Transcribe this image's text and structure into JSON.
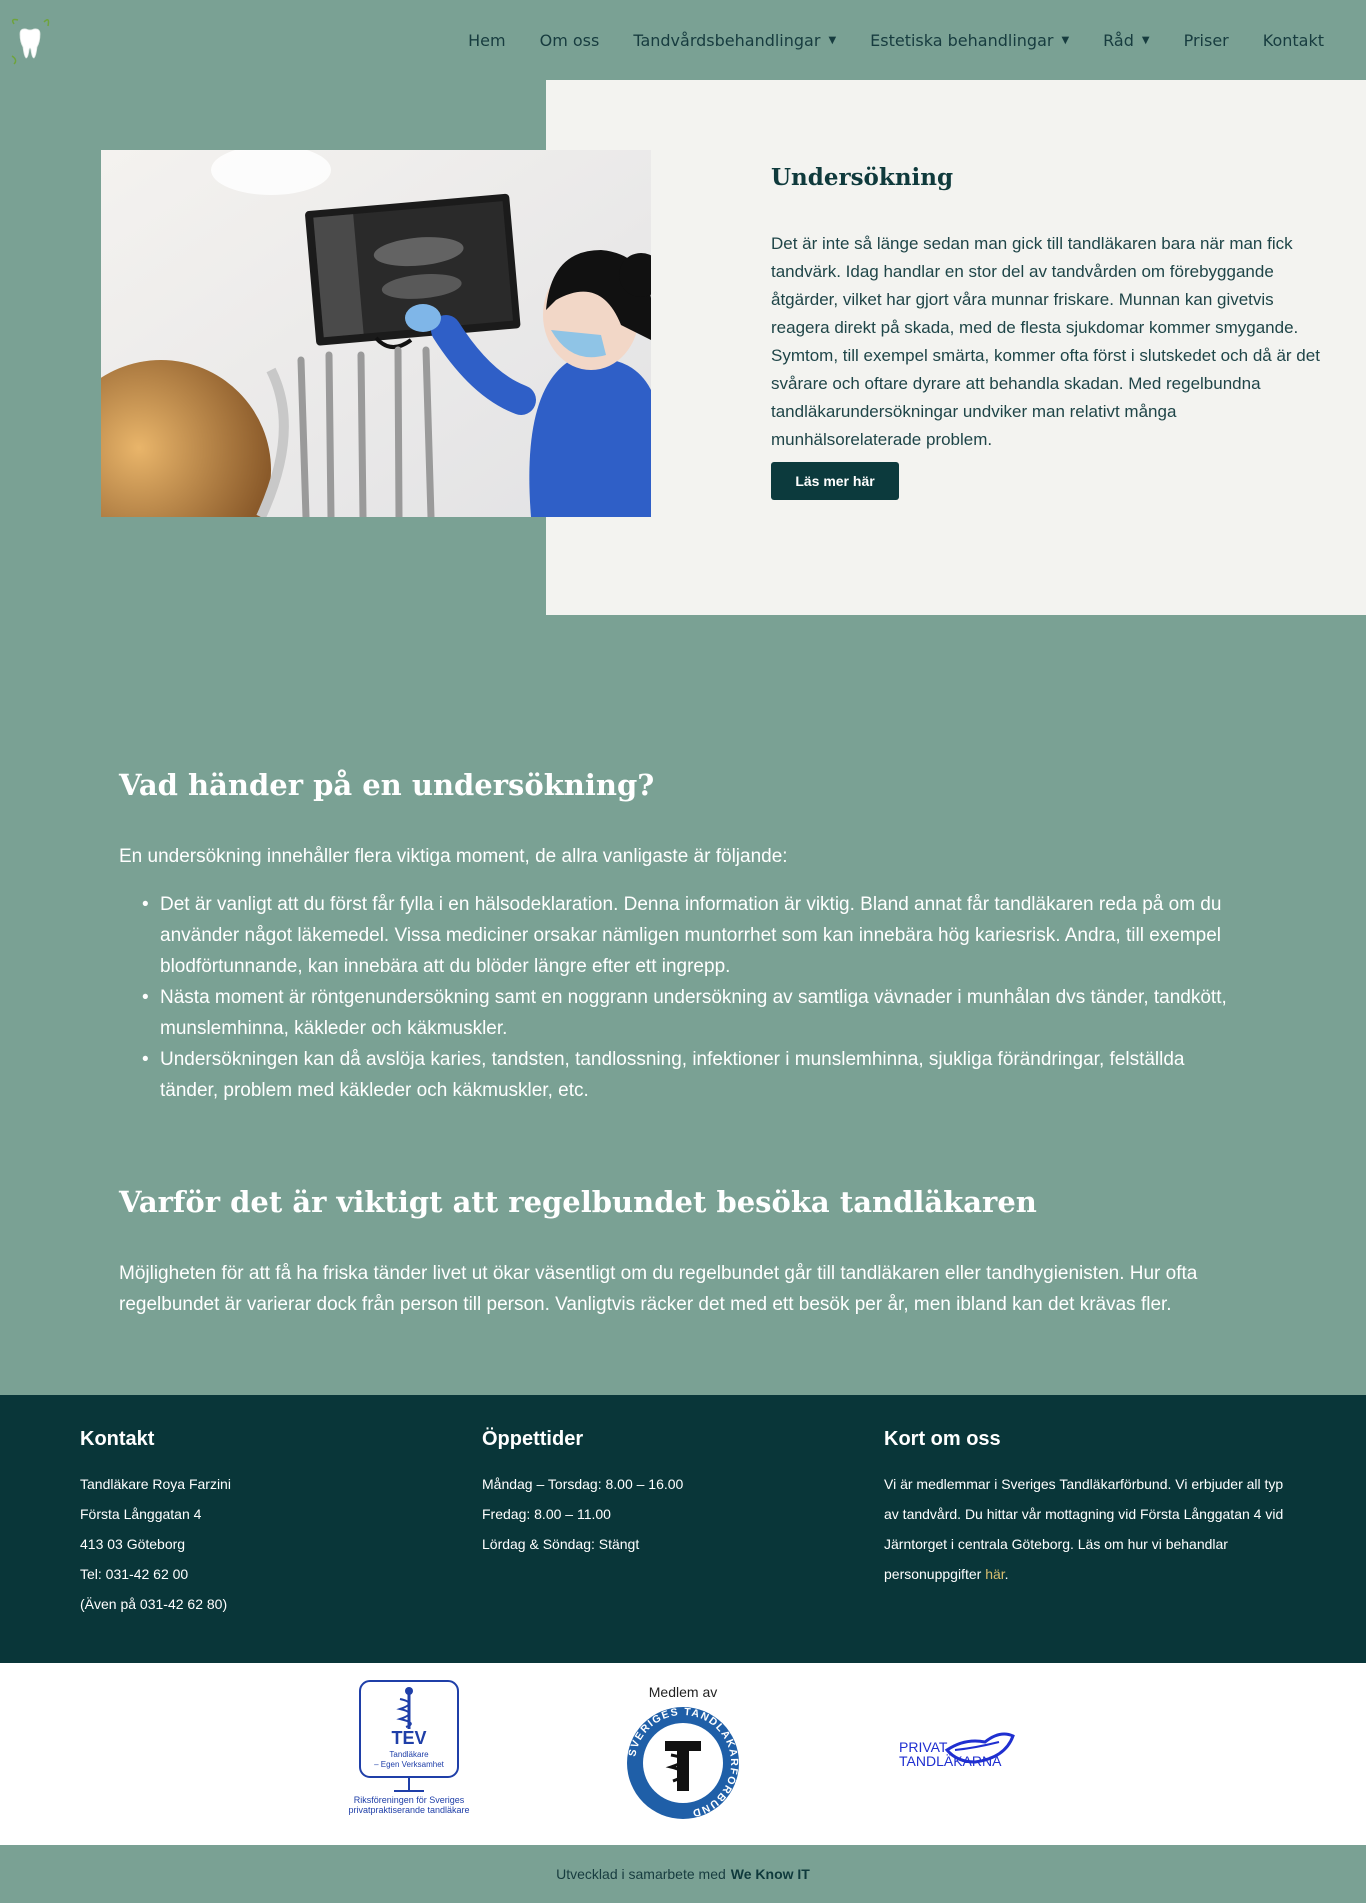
{
  "nav": {
    "items": [
      {
        "label": "Hem",
        "dropdown": false
      },
      {
        "label": "Om oss",
        "dropdown": false
      },
      {
        "label": "Tandvårdsbehandlingar",
        "dropdown": true
      },
      {
        "label": "Estetiska behandlingar",
        "dropdown": true
      },
      {
        "label": "Råd",
        "dropdown": true
      },
      {
        "label": "Priser",
        "dropdown": false
      },
      {
        "label": "Kontakt",
        "dropdown": false
      }
    ]
  },
  "hero": {
    "title": "Undersökning",
    "text": "Det är inte så länge sedan man gick till tandläkaren bara när man fick tandvärk. Idag handlar en stor del av tandvården om förebyggande åtgärder, vilket har gjort våra munnar friskare. Munnan kan givetvis reagera direkt på skada, med de flesta sjukdomar kommer smygande. Symtom, till exempel smärta, kommer ofta först i slutskedet och då är det svårare och oftare dyrare att behandla skadan. Med regelbundna tandläkarundersökningar undviker man relativt många munhälsorelaterade problem.",
    "button": "Läs mer här"
  },
  "section1": {
    "heading": "Vad händer på en undersökning?",
    "intro": "En undersökning innehåller flera viktiga moment, de allra vanligaste är följande:",
    "items": [
      "Det är vanligt att du först får fylla i en hälsodeklaration. Denna information är viktig. Bland annat får tandläkaren reda på om du använder något läkemedel. Vissa mediciner orsakar nämligen muntorrhet som kan innebära hög kariesrisk. Andra, till exempel blodförtunnande, kan innebära att du blöder längre efter ett ingrepp.",
      "Nästa moment är röntgenundersökning samt en noggrann undersökning av samtliga vävnader i munhålan dvs tänder, tandkött, munslemhinna, käkleder och käkmuskler.",
      "Undersökningen kan då avslöja karies, tandsten, tandlossning, infektioner i munslemhinna, sjukliga förändringar, felställda tänder, problem med käkleder och käkmuskler, etc."
    ]
  },
  "section2": {
    "heading": "Varför det är viktigt att regelbundet besöka tandläkaren",
    "text": "Möjligheten för att få ha friska tänder livet ut ökar väsentligt om du regelbundet går till tandläkaren eller tandhygienisten. Hur ofta regelbundet är varierar dock från person till person. Vanligtvis räcker det med ett besök per år, men ibland kan det krävas fler."
  },
  "footer": {
    "contact": {
      "heading": "Kontakt",
      "lines": [
        "Tandläkare Roya Farzini",
        "Första Långgatan 4",
        "413 03 Göteborg",
        "Tel: 031-42 62 00",
        "(Även på 031-42 62 80)"
      ]
    },
    "hours": {
      "heading": "Öppettider",
      "lines": [
        "Måndag – Torsdag: 8.00 – 16.00",
        "Fredag: 8.00 – 11.00",
        "Lördag & Söndag: Stängt"
      ]
    },
    "about": {
      "heading": "Kort om oss",
      "text": "Vi är medlemmar i Sveriges Tandläkarförbund. Vi erbjuder all typ av tandvård. Du hittar vår mottagning vid Första Långgatan 4 vid Järntorget i centrala Göteborg. Läs om hur vi behandlar personuppgifter ",
      "link": "här",
      "end": "."
    }
  },
  "logos": {
    "tev": {
      "name": "TEV",
      "line1": "Tandläkare",
      "line2": "– Egen Verksamhet",
      "caption1": "Riksföreningen för Sveriges",
      "caption2": "privatpraktiserande tandläkare"
    },
    "stf": {
      "top": "Medlem av",
      "ring": "SVERIGES TANDLÄKARFÖRBUND"
    },
    "pt": {
      "line1": "PRIVAT",
      "line2": "TANDLÄKARNA"
    }
  },
  "bottom": {
    "text": "Utvecklad i samarbete med",
    "brand": "We Know IT"
  },
  "colors": {
    "accent": "#7aa194",
    "dark": "#093639",
    "panel": "#f3f3f0",
    "link": "#d9bf6f",
    "logo_blue": "#1f3fa8"
  }
}
